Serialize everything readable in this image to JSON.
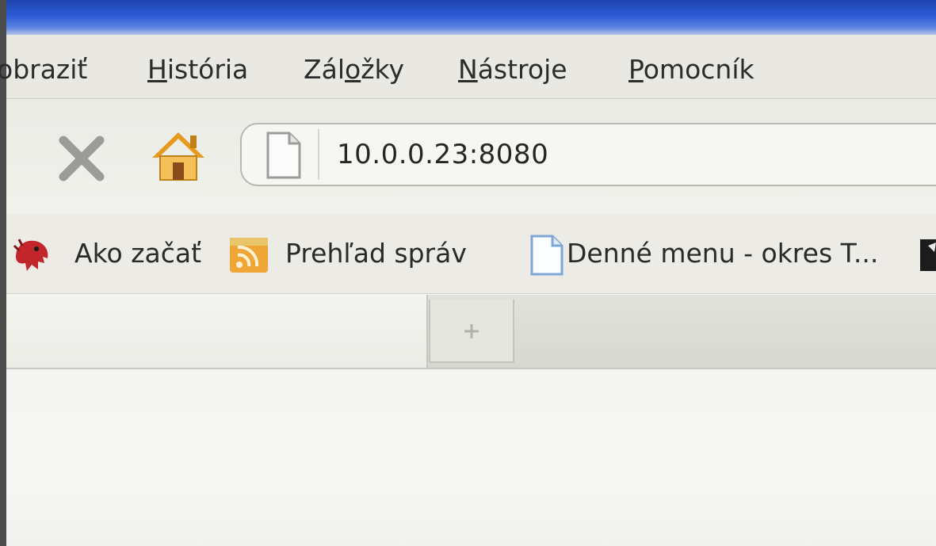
{
  "menubar": {
    "items": [
      {
        "label": "obraziť",
        "mnemonic_index": -1
      },
      {
        "label": "História",
        "mnemonic_index": 0
      },
      {
        "label": "Záložky",
        "mnemonic_index": 3
      },
      {
        "label": "Nástroje",
        "mnemonic_index": 0
      },
      {
        "label": "Pomocník",
        "mnemonic_index": 0
      }
    ]
  },
  "navbar": {
    "stop_icon": "stop-x-icon",
    "home_icon": "home-icon",
    "url": "10.0.0.23:8080"
  },
  "bookmarks": [
    {
      "label": "Ako začať",
      "icon": "dino-icon"
    },
    {
      "label": "Prehľad správ",
      "icon": "rss-feed-icon"
    },
    {
      "label": "Denné menu - okres T...",
      "icon": "page-icon"
    }
  ],
  "tabs": {
    "new_tab_icon": "plus-icon"
  },
  "colors": {
    "title_blue": "#2c5bd6",
    "chrome_bg": "#e9e8e2",
    "text": "#2a2a2a"
  }
}
